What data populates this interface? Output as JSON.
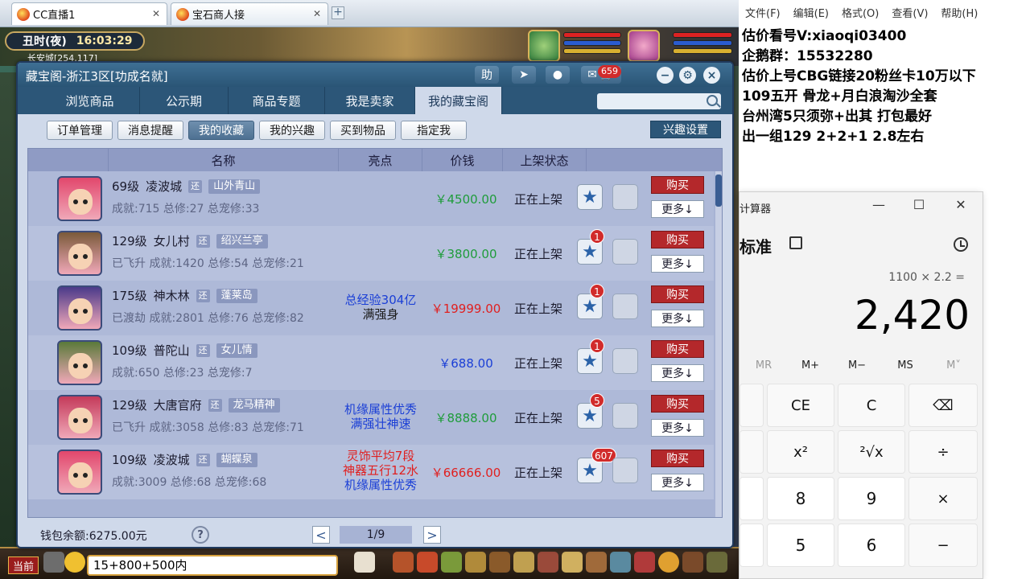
{
  "browser": {
    "tabs": [
      {
        "label": "CC直播1",
        "close": "✕"
      },
      {
        "label": "宝石商人接",
        "close": "✕"
      }
    ],
    "add_tab": "+"
  },
  "game": {
    "time_label": "丑时(夜)",
    "clock": "16:03:29",
    "location": "长安城[254,117]",
    "bottom_channel": "当前",
    "chat_input": "15+800+500内"
  },
  "dialog": {
    "title": "藏宝阁-浙江3区[功成名就]",
    "title_buttons": {
      "help": "助",
      "mail_badge": "659"
    },
    "nav_tabs": [
      "浏览商品",
      "公示期",
      "商品专题",
      "我是卖家",
      "我的藏宝阁"
    ],
    "active_nav": "我的藏宝阁",
    "sub_buttons": [
      "订单管理",
      "消息提醒",
      "我的收藏",
      "我的兴趣",
      "买到物品",
      "指定我"
    ],
    "active_sub": "我的收藏",
    "interest_settings": "兴趣设置",
    "columns": [
      "名称",
      "亮点",
      "价钱",
      "上架状态"
    ],
    "rows": [
      {
        "level": "69级",
        "school": "凌波城",
        "huan": "还",
        "server": "山外青山",
        "stats": "成就:715 总修:27 总宠修:33",
        "highlight": [],
        "price": "￥4500.00",
        "price_color": "#1f9c3b",
        "status": "正在上架",
        "fav_badge": "",
        "buy": "购买",
        "more": "更多↓",
        "hair": "#e2476c"
      },
      {
        "level": "129级",
        "school": "女儿村",
        "huan": "还",
        "server": "绍兴兰亭",
        "stats": "已飞升 成就:1420 总修:54 总宠修:21",
        "highlight": [],
        "price": "￥3800.00",
        "price_color": "#1f9c3b",
        "status": "正在上架",
        "fav_badge": "1",
        "buy": "购买",
        "more": "更多↓",
        "hair": "#7a5a3a"
      },
      {
        "level": "175级",
        "school": "神木林",
        "huan": "还",
        "server": "蓬莱岛",
        "stats": "已渡劫 成就:2801 总修:76 总宠修:82",
        "highlight": [
          {
            "text": "总经验304亿",
            "color": "#1b3fd6"
          },
          {
            "text": "满强身",
            "color": "#1b1b1b"
          }
        ],
        "price": "￥19999.00",
        "price_color": "#e02020",
        "status": "正在上架",
        "fav_badge": "1",
        "buy": "购买",
        "more": "更多↓",
        "hair": "#4b3a8a"
      },
      {
        "level": "109级",
        "school": "普陀山",
        "huan": "还",
        "server": "女儿情",
        "stats": "成就:650 总修:23 总宠修:7",
        "highlight": [],
        "price": "￥688.00",
        "price_color": "#1b3fd6",
        "status": "正在上架",
        "fav_badge": "1",
        "buy": "购买",
        "more": "更多↓",
        "hair": "#5a7a3a"
      },
      {
        "level": "129级",
        "school": "大唐官府",
        "huan": "还",
        "server": "龙马精神",
        "stats": "已飞升 成就:3058 总修:83 总宠修:71",
        "highlight": [
          {
            "text": "机缘属性优秀",
            "color": "#1b3fd6"
          },
          {
            "text": "满强壮神速",
            "color": "#1b3fd6"
          }
        ],
        "price": "￥8888.00",
        "price_color": "#1f9c3b",
        "status": "正在上架",
        "fav_badge": "5",
        "buy": "购买",
        "more": "更多↓",
        "hair": "#c43a5a"
      },
      {
        "level": "109级",
        "school": "凌波城",
        "huan": "还",
        "server": "蝴蝶泉",
        "stats": "成就:3009 总修:68 总宠修:68",
        "highlight": [
          {
            "text": "灵饰平均7段",
            "color": "#e02020"
          },
          {
            "text": "神器五行12水",
            "color": "#e02020"
          },
          {
            "text": "机缘属性优秀",
            "color": "#1b3fd6"
          }
        ],
        "price": "￥66666.00",
        "price_color": "#e02020",
        "status": "正在上架",
        "fav_badge": "607",
        "buy": "购买",
        "more": "更多↓",
        "hair": "#e2476c"
      }
    ],
    "wallet": "钱包余额:6275.00元",
    "help": "?",
    "page": "1/9",
    "prev": "<",
    "next": ">"
  },
  "notepad": {
    "menu": [
      "文件(F)",
      "编辑(E)",
      "格式(O)",
      "查看(V)",
      "帮助(H)"
    ],
    "lines": [
      "估价看号V:xiaoqi03400",
      "企鹅群：15532280",
      "估价上号CBG链接20粉丝卡10万以下",
      "109五开 骨龙+月白浪淘沙全套",
      "台州湾5只须弥+出其 打包最好",
      "出一组129 2+2+1   2.8左右"
    ]
  },
  "calculator": {
    "title": "计算器",
    "mode": "标准",
    "expression": "1100 × 2.2 =",
    "result": "2,420",
    "memory": [
      "MR",
      "M+",
      "M−",
      "MS",
      "M˅"
    ],
    "keys_row1": [
      "CE",
      "C",
      "⌫"
    ],
    "keys_row2": [
      "x²",
      "²√x",
      "÷"
    ],
    "keys_row3": [
      "8",
      "9",
      "×"
    ],
    "keys_row4": [
      "5",
      "6",
      "−"
    ]
  }
}
